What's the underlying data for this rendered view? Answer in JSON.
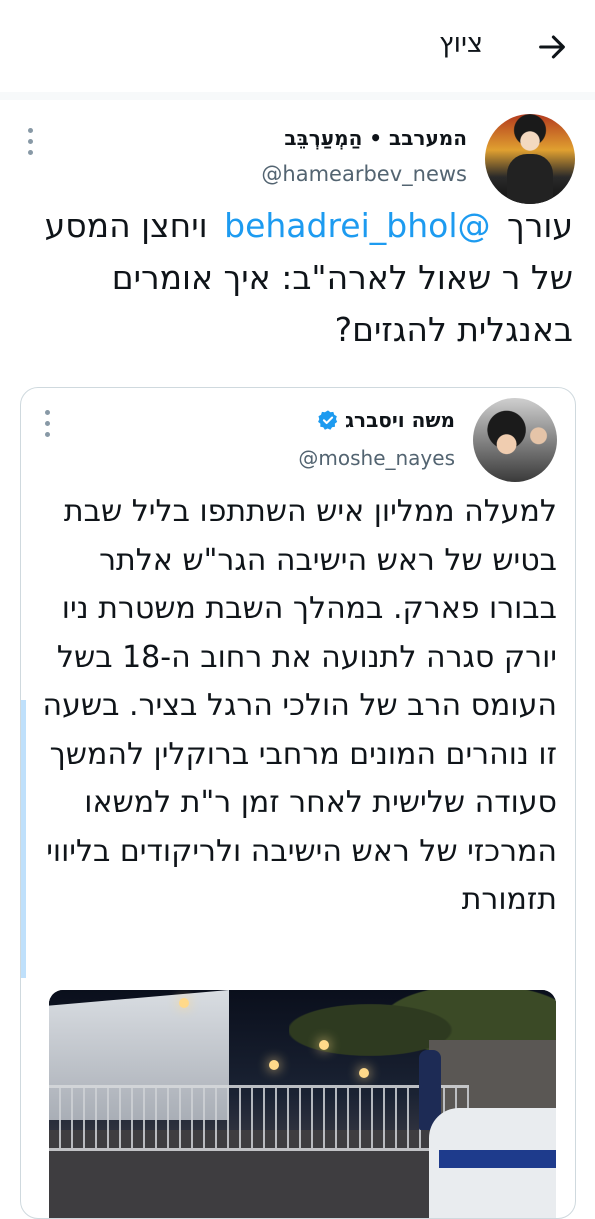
{
  "header": {
    "title": "ציוץ",
    "back_icon": "arrow-right-icon"
  },
  "tweet": {
    "author_name": "המערבב • הַמְעַרְבֵּב",
    "author_handle": "@hamearbev_news",
    "text_before_mention": "עורך",
    "mention": "@behadrei_bhol",
    "text_after_mention": "ויחצן המסע של ר שאול לארה\"ב: איך אומרים באנגלית להגזים?"
  },
  "quote": {
    "author_name": "משה ויסברג",
    "verified": true,
    "author_handle": "@moshe_nayes",
    "text": "למעלה ממליון איש השתתפו בליל שבת בטיש של ראש הישיבה הגר\"ש אלתר בבורו פארק. במהלך השבת משטרת ניו יורק סגרה לתנועה את רחוב ה-18 בשל העומס הרב של הולכי הרגל בציר. בשעה זו נוהרים המונים מרחבי ברוקלין להמשך סעודה שלישית לאחר זמן ר\"ת למשאו המרכזי של ראש הישיבה ולריקודים בליווי תזמורת"
  },
  "colors": {
    "accent": "#1d9bf0",
    "secondary_text": "#536471",
    "border": "#cfd9de"
  }
}
